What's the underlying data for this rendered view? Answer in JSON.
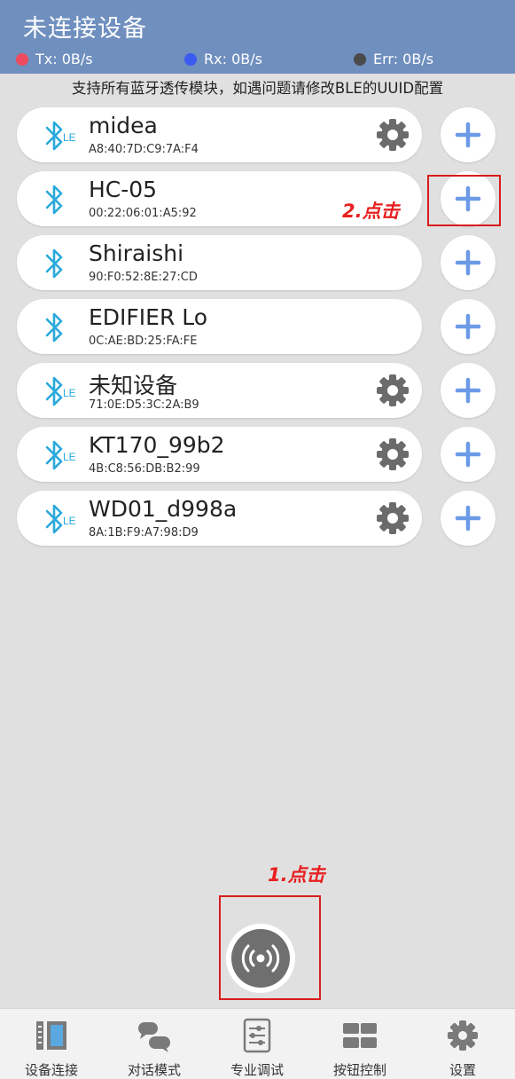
{
  "header": {
    "title": "未连接设备",
    "tx": "Tx: 0B/s",
    "rx": "Rx: 0B/s",
    "err": "Err: 0B/s",
    "colors": {
      "bar": "#6f8fbf",
      "tx_dot": "#ef4b5f",
      "rx_dot": "#3b5bf0",
      "err_dot": "#4a4a4a"
    }
  },
  "hint": "支持所有蓝牙透传模块，如遇问题请修改BLE的UUID配置",
  "devices": [
    {
      "name": "midea",
      "mac": "A8:40:7D:C9:7A:F4",
      "icon": "bluetooth-le-icon",
      "has_settings": true
    },
    {
      "name": "HC-05",
      "mac": "00:22:06:01:A5:92",
      "icon": "bluetooth-icon",
      "has_settings": false
    },
    {
      "name": "Shiraishi",
      "mac": "90:F0:52:8E:27:CD",
      "icon": "bluetooth-icon",
      "has_settings": false
    },
    {
      "name": "EDIFIER Lo",
      "mac": "0C:AE:BD:25:FA:FE",
      "icon": "bluetooth-icon",
      "has_settings": false
    },
    {
      "name": "未知设备",
      "mac": "71:0E:D5:3C:2A:B9",
      "icon": "bluetooth-le-icon",
      "has_settings": true
    },
    {
      "name": "KT170_99b2",
      "mac": "4B:C8:56:DB:B2:99",
      "icon": "bluetooth-le-icon",
      "has_settings": true
    },
    {
      "name": "WD01_d998a",
      "mac": "8A:1B:F9:A7:98:D9",
      "icon": "bluetooth-le-icon",
      "has_settings": true
    }
  ],
  "ble_badge": "LE",
  "annotations": {
    "step2": "2.点击",
    "step1": "1.点击"
  },
  "tabs": [
    {
      "label": "设备连接",
      "icon": "device-connect-icon"
    },
    {
      "label": "对话模式",
      "icon": "chat-icon"
    },
    {
      "label": "专业调试",
      "icon": "debug-sliders-icon"
    },
    {
      "label": "按钮控制",
      "icon": "button-grid-icon"
    },
    {
      "label": "设置",
      "icon": "gear-icon"
    }
  ]
}
